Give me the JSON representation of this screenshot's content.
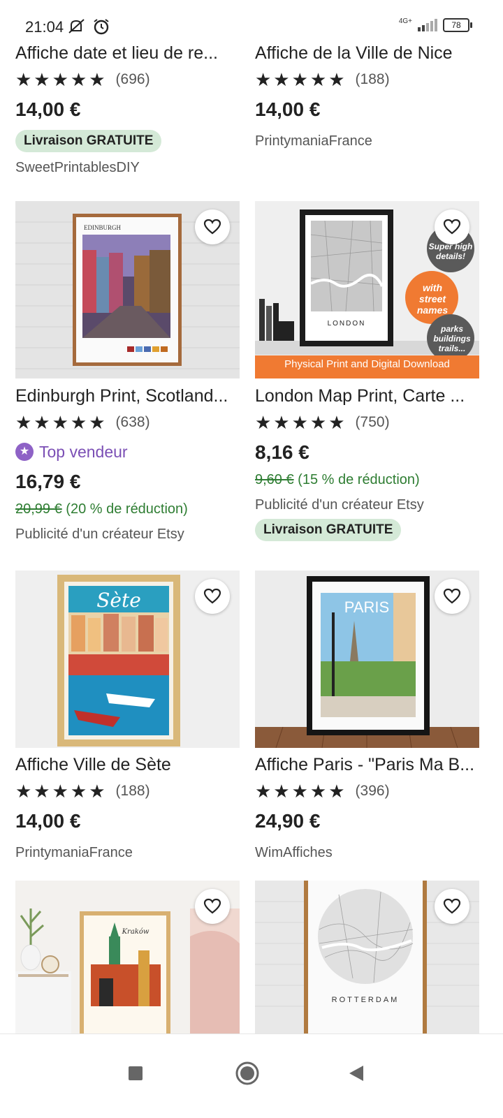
{
  "status_bar": {
    "time": "21:04",
    "network": "4G+",
    "battery": "78"
  },
  "products": [
    {
      "title": "Affiche date et lieu de re...",
      "rating_count": "(696)",
      "price": "14,00 €",
      "free_shipping": "Livraison GRATUITE",
      "shop": "SweetPrintablesDIY"
    },
    {
      "title": "Affiche de la Ville de Nice",
      "rating_count": "(188)",
      "price": "14,00 €",
      "shop": "PrintymaniaFrance"
    },
    {
      "title": "Edinburgh Print, Scotland...",
      "rating_count": "(638)",
      "badge": "Top vendeur",
      "price": "16,79 €",
      "original_price": "20,99 €",
      "discount": "(20 % de réduction)",
      "ad_label": "Publicité d'un créateur Etsy",
      "image_text": "EDINBURGH"
    },
    {
      "title": "London Map Print, Carte ...",
      "rating_count": "(750)",
      "price": "8,16 €",
      "original_price": "9,60 €",
      "discount": "(15 % de réduction)",
      "ad_label": "Publicité d'un créateur Etsy",
      "free_shipping": "Livraison GRATUITE",
      "image_text": {
        "city": "LONDON",
        "badge1": "Super high details!",
        "badge2": "with street names",
        "badge3": "parks buildings trails...",
        "banner": "Physical Print and Digital Download"
      }
    },
    {
      "title": "Affiche Ville de Sète",
      "rating_count": "(188)",
      "price": "14,00 €",
      "shop": "PrintymaniaFrance",
      "image_text": "Sète"
    },
    {
      "title": "Affiche Paris - \"Paris Ma B...",
      "rating_count": "(396)",
      "price": "24,90 €",
      "shop": "WimAffiches",
      "image_text": "PARIS"
    },
    {
      "title": "",
      "image_text": "Kraków"
    },
    {
      "title": "",
      "image_text": "ROTTERDAM"
    }
  ],
  "stars": "★★★★★",
  "colors": {
    "free_shipping_bg": "#d4e9d7",
    "discount": "#2e7d32",
    "top_seller": "#7b4fb5",
    "orange_banner": "#f07a32"
  },
  "nav": {
    "icons": [
      "square-icon",
      "home-circle-icon",
      "back-triangle-icon"
    ]
  }
}
